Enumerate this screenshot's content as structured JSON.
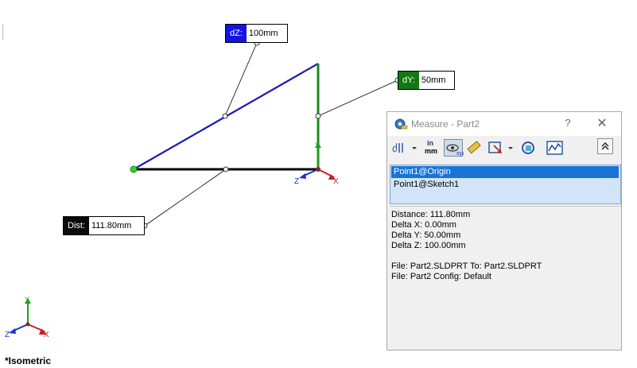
{
  "callouts": {
    "dz": {
      "tag": "dZ:",
      "value": "100mm"
    },
    "dy": {
      "tag": "dY:",
      "value": "50mm"
    },
    "dist": {
      "tag": "Dist:",
      "value": "111.80mm"
    }
  },
  "triad_main": {
    "x": "X",
    "y": "Y",
    "z": "Z"
  },
  "triad_corner": {
    "x": "X",
    "y": "Y",
    "z": "Z"
  },
  "view_label": "*Isometric",
  "measure_dialog": {
    "title": "Measure - Part2",
    "help": "?",
    "close": "✕",
    "unit_icon_text": {
      "top": "in",
      "bottom": "mm"
    },
    "selections": [
      "Point1@Origin",
      "Point1@Sketch1"
    ],
    "results": [
      "Distance: 111.80mm",
      "Delta X: 0.00mm",
      "Delta Y: 50.00mm",
      "Delta Z: 100.00mm"
    ],
    "file_info": [
      "File: Part2.SLDPRT To: Part2.SLDPRT",
      "File: Part2 Config: Default"
    ]
  },
  "colors": {
    "dz_line": "#1a1ab8",
    "dy_line": "#1a8c1a",
    "dist_line": "#000000",
    "axis_x": "#c81e1e",
    "axis_y": "#1e9e1e",
    "axis_z": "#1e2ec8",
    "origin_point": "#2bd62b",
    "selection_highlight": "#1a74d6"
  }
}
